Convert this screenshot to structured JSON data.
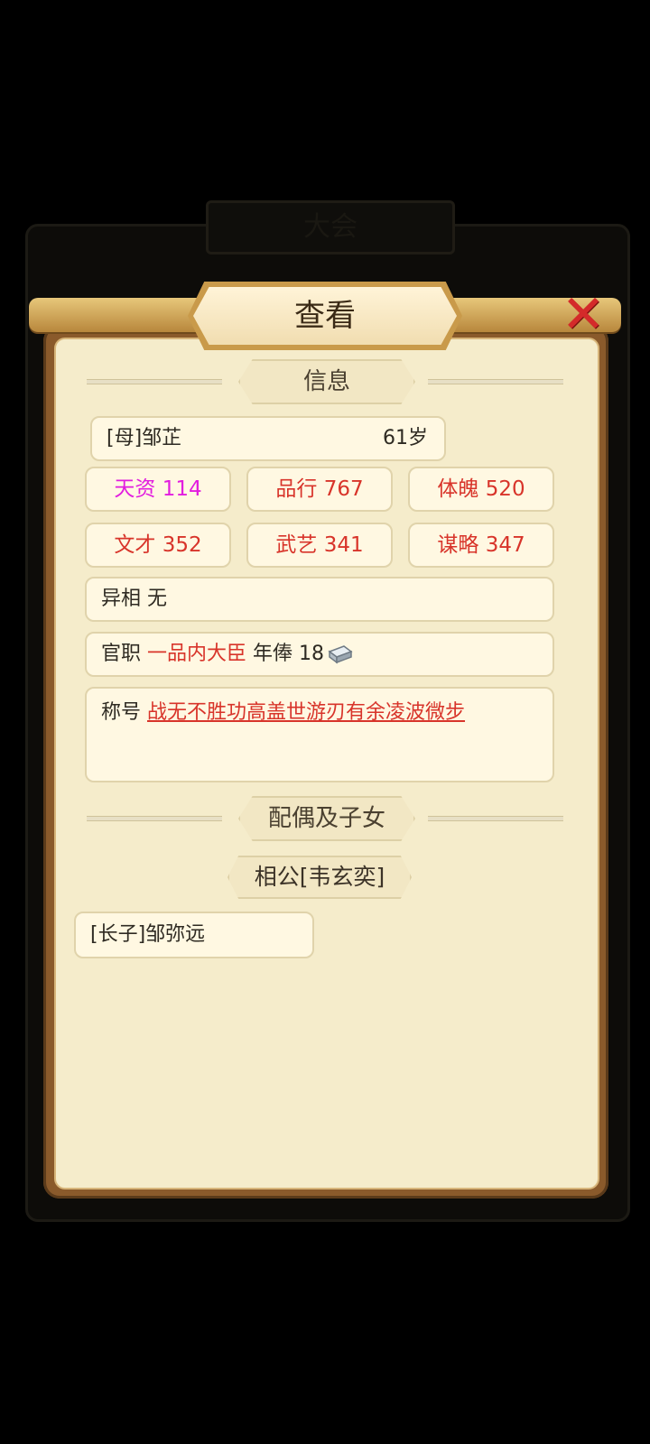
{
  "background_tab": {
    "label": "大会"
  },
  "dialog": {
    "title": "查看",
    "close_label": "✕"
  },
  "info_section": {
    "label": "信息"
  },
  "person": {
    "name": "[母]邹芷",
    "age": "61岁"
  },
  "stats": [
    {
      "label": "天资",
      "value": "114",
      "color": "#e21ddf"
    },
    {
      "label": "品行",
      "value": "767",
      "color": "#d8342a"
    },
    {
      "label": "体魄",
      "value": "520",
      "color": "#d8342a"
    },
    {
      "label": "文才",
      "value": "352",
      "color": "#d8342a"
    },
    {
      "label": "武艺",
      "value": "341",
      "color": "#d8342a"
    },
    {
      "label": "谋略",
      "value": "347",
      "color": "#d8342a"
    }
  ],
  "appearance": {
    "label": "异相",
    "value": "无"
  },
  "office": {
    "label": "官职",
    "value": "一品内大臣",
    "salary_label": "年俸",
    "salary_value": "18",
    "salary_icon": "silver-ingot-icon"
  },
  "titles": {
    "label": "称号",
    "value": "战无不胜功高盖世游刃有余凌波微步"
  },
  "family_section": {
    "label": "配偶及子女"
  },
  "spouse": {
    "label": "相公[韦玄奕]"
  },
  "children": [
    {
      "label": "[长子]邹弥远"
    }
  ]
}
